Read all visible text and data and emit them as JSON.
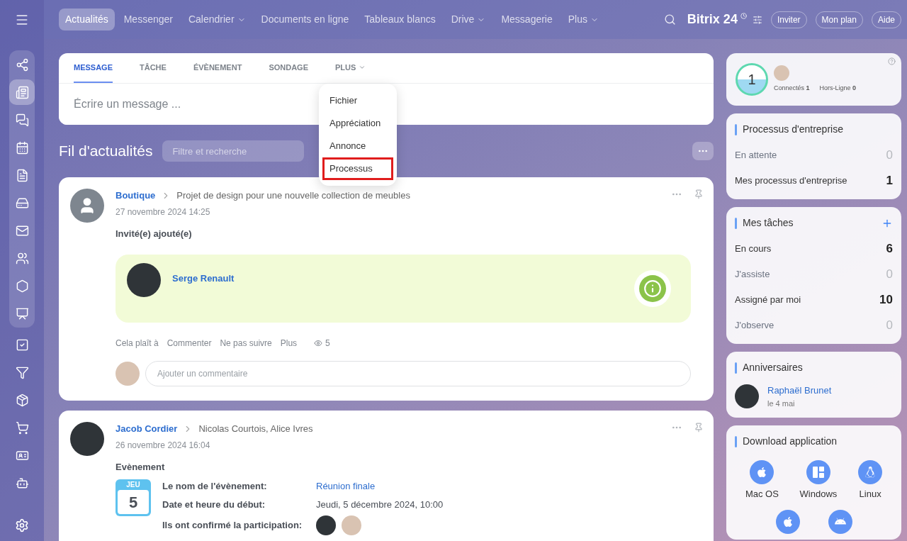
{
  "top_nav": {
    "items": [
      {
        "label": "Actualités",
        "selected": true,
        "dropdown": false
      },
      {
        "label": "Messenger",
        "selected": false,
        "dropdown": false
      },
      {
        "label": "Calendrier",
        "selected": false,
        "dropdown": true
      },
      {
        "label": "Documents en ligne",
        "selected": false,
        "dropdown": false
      },
      {
        "label": "Tableaux blancs",
        "selected": false,
        "dropdown": false
      },
      {
        "label": "Drive",
        "selected": false,
        "dropdown": true
      },
      {
        "label": "Messagerie",
        "selected": false,
        "dropdown": false
      },
      {
        "label": "Plus",
        "selected": false,
        "dropdown": true
      }
    ],
    "brand": "Bitrix 24",
    "buttons": [
      "Inviter",
      "Mon plan",
      "Aide"
    ]
  },
  "sidebar": {
    "pinned_items": [
      {
        "selected": false
      },
      {
        "selected": true
      },
      {
        "selected": false
      },
      {
        "selected": false
      },
      {
        "selected": false
      },
      {
        "selected": false
      },
      {
        "selected": false
      },
      {
        "selected": false
      },
      {
        "selected": false
      },
      {
        "selected": false
      }
    ],
    "items": [
      {
        "selected": false
      },
      {
        "selected": false
      },
      {
        "selected": false
      },
      {
        "selected": false
      },
      {
        "selected": false
      },
      {
        "selected": false
      }
    ]
  },
  "composer": {
    "tabs": [
      {
        "label": "MESSAGE",
        "selected": true,
        "dropdown": false
      },
      {
        "label": "TÂCHE",
        "selected": false,
        "dropdown": false
      },
      {
        "label": "ÉVÈNEMENT",
        "selected": false,
        "dropdown": false
      },
      {
        "label": "SONDAGE",
        "selected": false,
        "dropdown": false
      },
      {
        "label": "PLUS",
        "selected": false,
        "dropdown": true
      }
    ],
    "placeholder": "Écrire un message ...",
    "menu": [
      {
        "label": "Fichier",
        "selected": false
      },
      {
        "label": "Appréciation",
        "selected": false
      },
      {
        "label": "Annonce",
        "selected": false
      },
      {
        "label": "Processus",
        "selected": true
      }
    ]
  },
  "feed": {
    "title": "Fil d'actualités",
    "filter_placeholder": "Filtre et recherche"
  },
  "posts": [
    {
      "kind": "invite",
      "author": "Boutique",
      "target": "Projet de design pour une nouvelle collection de meubles",
      "date": "27 novembre 2024 14:25",
      "heading": "Invité(e) ajouté(e)",
      "guest": "Serge Renault",
      "actions": [
        "Cela plaît à",
        "Commenter",
        "Ne pas suivre",
        "Plus"
      ],
      "views": "5",
      "comment_placeholder": "Ajouter un commentaire"
    },
    {
      "kind": "event",
      "author": "Jacob Cordier",
      "target": "Nicolas Courtois, Alice Ivres",
      "date": "26 novembre 2024 16:04",
      "heading": "Evènement",
      "calendar": {
        "weekday": "JEU",
        "day": "5"
      },
      "fields": [
        {
          "kind": "link",
          "label": "Le nom de l'évènement:",
          "value": "Réunion finale"
        },
        {
          "kind": "text",
          "label": "Date et heure du début:",
          "value": "Jeudi, 5 décembre 2024, 10:00"
        },
        {
          "kind": "avatars",
          "label": "Ils ont confirmé la participation:",
          "avatars": [
            {
              "kind": "photo"
            },
            {
              "kind": "photo"
            }
          ]
        }
      ]
    }
  ],
  "online": {
    "count": "1",
    "online_label": "Connectés",
    "online_count": "1",
    "offline_label": "Hors-Ligne",
    "offline_count": "0"
  },
  "widgets": [
    {
      "kind": "counters",
      "title": "Processus d'entreprise",
      "add": false,
      "rows": [
        {
          "label": "En attente",
          "value": "0",
          "highlighted": false
        },
        {
          "label": "Mes processus d'entreprise",
          "value": "1",
          "highlighted": true
        }
      ]
    },
    {
      "kind": "counters",
      "title": "Mes tâches",
      "add": true,
      "rows": [
        {
          "label": "En cours",
          "value": "6",
          "highlighted": true
        },
        {
          "label": "J'assiste",
          "value": "0",
          "highlighted": false
        },
        {
          "label": "Assigné par moi",
          "value": "10",
          "highlighted": true
        },
        {
          "label": "J'observe",
          "value": "0",
          "highlighted": false
        }
      ]
    },
    {
      "kind": "birthdays",
      "title": "Anniversaires",
      "people": [
        {
          "name": "Raphaël Brunet",
          "date": "le 4 mai"
        }
      ]
    },
    {
      "kind": "apps",
      "title": "Download application",
      "apps": [
        {
          "kind": "apple",
          "label": "Mac OS"
        },
        {
          "kind": "grid",
          "label": "Windows"
        },
        {
          "kind": "penguin",
          "label": "Linux"
        }
      ],
      "mobile_apps": [
        {
          "kind": "apple"
        },
        {
          "kind": "robot"
        }
      ]
    }
  ]
}
